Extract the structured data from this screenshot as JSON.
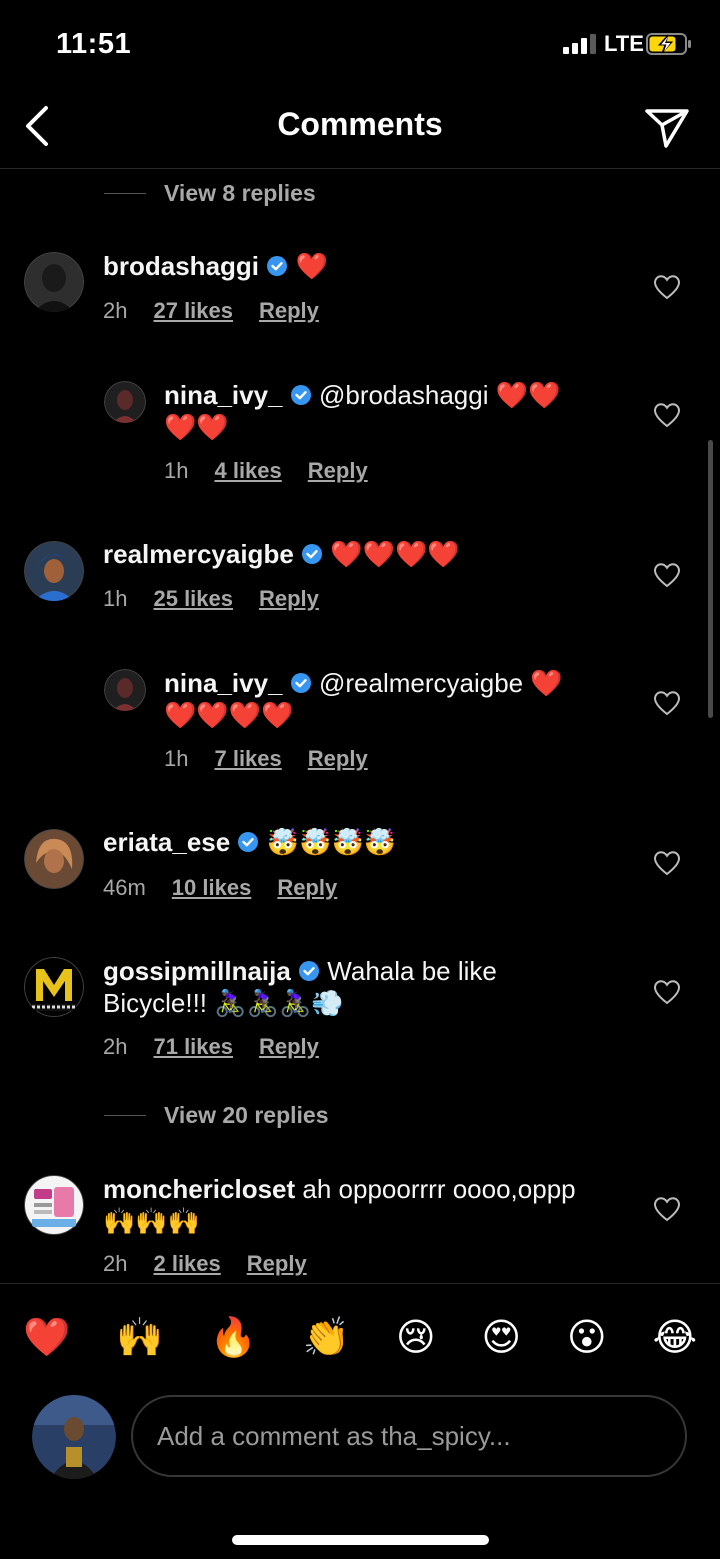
{
  "status": {
    "time": "11:51",
    "network": "LTE"
  },
  "nav": {
    "title": "Comments"
  },
  "view_replies_top": "View 8 replies",
  "view_replies_mid": "View 20 replies",
  "comments": [
    {
      "user": "brodashaggi",
      "text": "❤️",
      "time": "2h",
      "likes": "27 likes",
      "reply": "Reply"
    },
    {
      "user": "nina_ivy_",
      "text": "@brodashaggi ❤️❤️",
      "text2": "❤️❤️",
      "time": "1h",
      "likes": "4 likes",
      "reply": "Reply"
    },
    {
      "user": "realmercyaigbe",
      "text": "❤️❤️❤️❤️",
      "time": "1h",
      "likes": "25 likes",
      "reply": "Reply"
    },
    {
      "user": "nina_ivy_",
      "text": "@realmercyaigbe ❤️",
      "text2": "❤️❤️❤️❤️",
      "time": "1h",
      "likes": "7 likes",
      "reply": "Reply"
    },
    {
      "user": "eriata_ese",
      "text": "🤯🤯🤯🤯",
      "time": "46m",
      "likes": "10 likes",
      "reply": "Reply"
    },
    {
      "user": "gossipmillnaija",
      "text": "Wahala be like",
      "text2": "Bicycle!!! 🚴🏿‍♀️🚴🏿‍♀️🚴🏿‍♀️💨",
      "time": "2h",
      "likes": "71 likes",
      "reply": "Reply"
    },
    {
      "user": "monchericloset",
      "text": "ah oppoorrrr oooo,oppp",
      "text2": "🙌🙌🙌",
      "time": "2h",
      "likes": "2 likes",
      "reply": "Reply"
    }
  ],
  "quick_emojis": [
    "❤️",
    "🙌",
    "🔥",
    "👏",
    "😢",
    "😍",
    "😮",
    "😂"
  ],
  "composer": {
    "placeholder": "Add a comment as tha_spicy..."
  },
  "colors": {
    "background": "#000000",
    "verified": "#3797f0",
    "muted": "#a8a8a8"
  }
}
